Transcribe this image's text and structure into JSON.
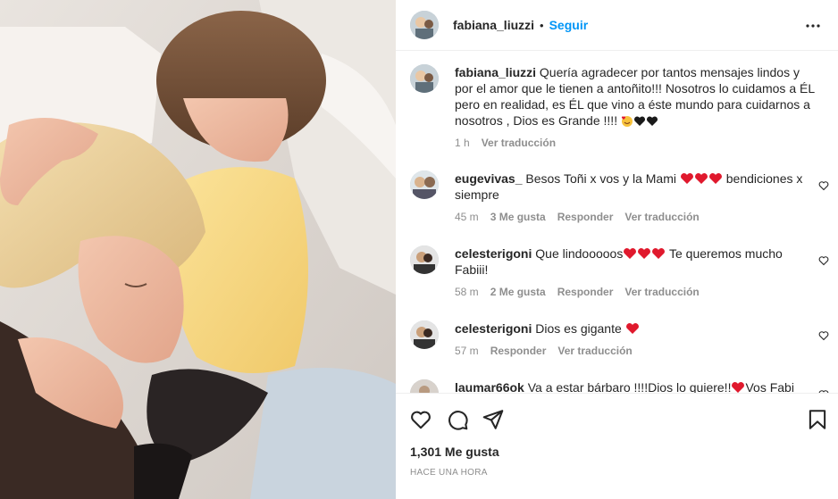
{
  "post": {
    "username": "fabiana_liuzzi",
    "dot": "•",
    "follow_label": "Seguir",
    "caption": {
      "username": "fabiana_liuzzi",
      "text": "Quería agradecer por tantos mensajes lindos y por el amor que le tienen a antoñito!!! Nosotros lo cuidamos a ÉL pero en realidad, es ÉL que vino a éste mundo para cuidarnos a nosotros , Dios es Grande !!!! ",
      "time": "1 h",
      "translate": "Ver traducción"
    },
    "likes": "1,301 Me gusta",
    "posted": "HACE UNA HORA"
  },
  "comments": [
    {
      "username": "eugevivas_",
      "text": "Besos Toñi x vos y la Mami ",
      "text_after": " bendiciones x siempre",
      "time": "45 m",
      "likes": "3 Me gusta",
      "reply": "Responder",
      "translate": "Ver traducción"
    },
    {
      "username": "celesterigoni",
      "text": "Que lindooooos",
      "text_after": " Te queremos mucho Fabiii!",
      "time": "58 m",
      "likes": "2 Me gusta",
      "reply": "Responder",
      "translate": "Ver traducción"
    },
    {
      "username": "celesterigoni",
      "text": "Dios es gigante ",
      "text_after": "",
      "time": "57 m",
      "reply": "Responder",
      "translate": "Ver traducción"
    },
    {
      "username": "laumar66ok",
      "text": "Va a estar bárbaro !!!!Dios lo quiere!!",
      "text_after": "Vos Fabi"
    }
  ],
  "icons": {
    "more": "more-options-icon",
    "like": "heart-icon",
    "comment": "comment-icon",
    "share": "share-icon",
    "save": "bookmark-icon"
  },
  "colors": {
    "follow": "#0095f6",
    "meta": "#8e8e8e",
    "heart_emoji": "#e0192d"
  }
}
